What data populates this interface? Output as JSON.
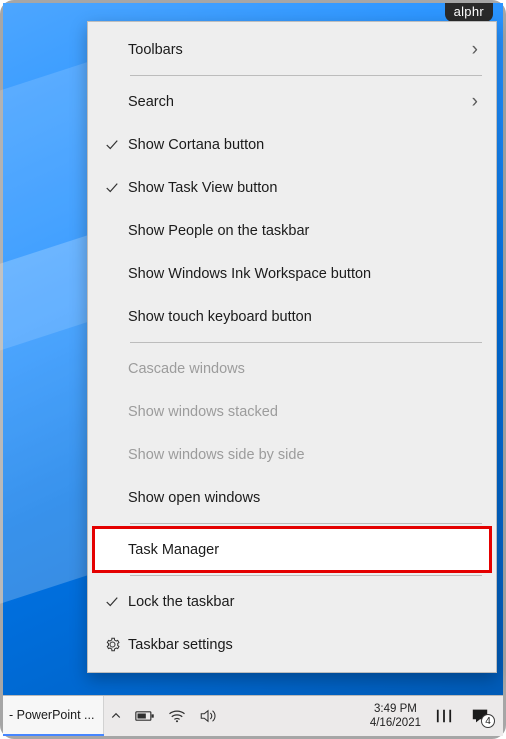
{
  "brand": "alphr",
  "menu": {
    "toolbars": "Toolbars",
    "search": "Search",
    "show_cortana": "Show Cortana button",
    "show_taskview": "Show Task View button",
    "show_people": "Show People on the taskbar",
    "show_ink": "Show Windows Ink Workspace button",
    "show_touchkb": "Show touch keyboard button",
    "cascade": "Cascade windows",
    "stacked": "Show windows stacked",
    "sidebyside": "Show windows side by side",
    "show_open": "Show open windows",
    "task_manager": "Task Manager",
    "lock_taskbar": "Lock the taskbar",
    "taskbar_settings": "Taskbar settings"
  },
  "taskbar": {
    "app": "- PowerPoint ...",
    "time": "3:49 PM",
    "date": "4/16/2021",
    "notif_count": "4"
  }
}
